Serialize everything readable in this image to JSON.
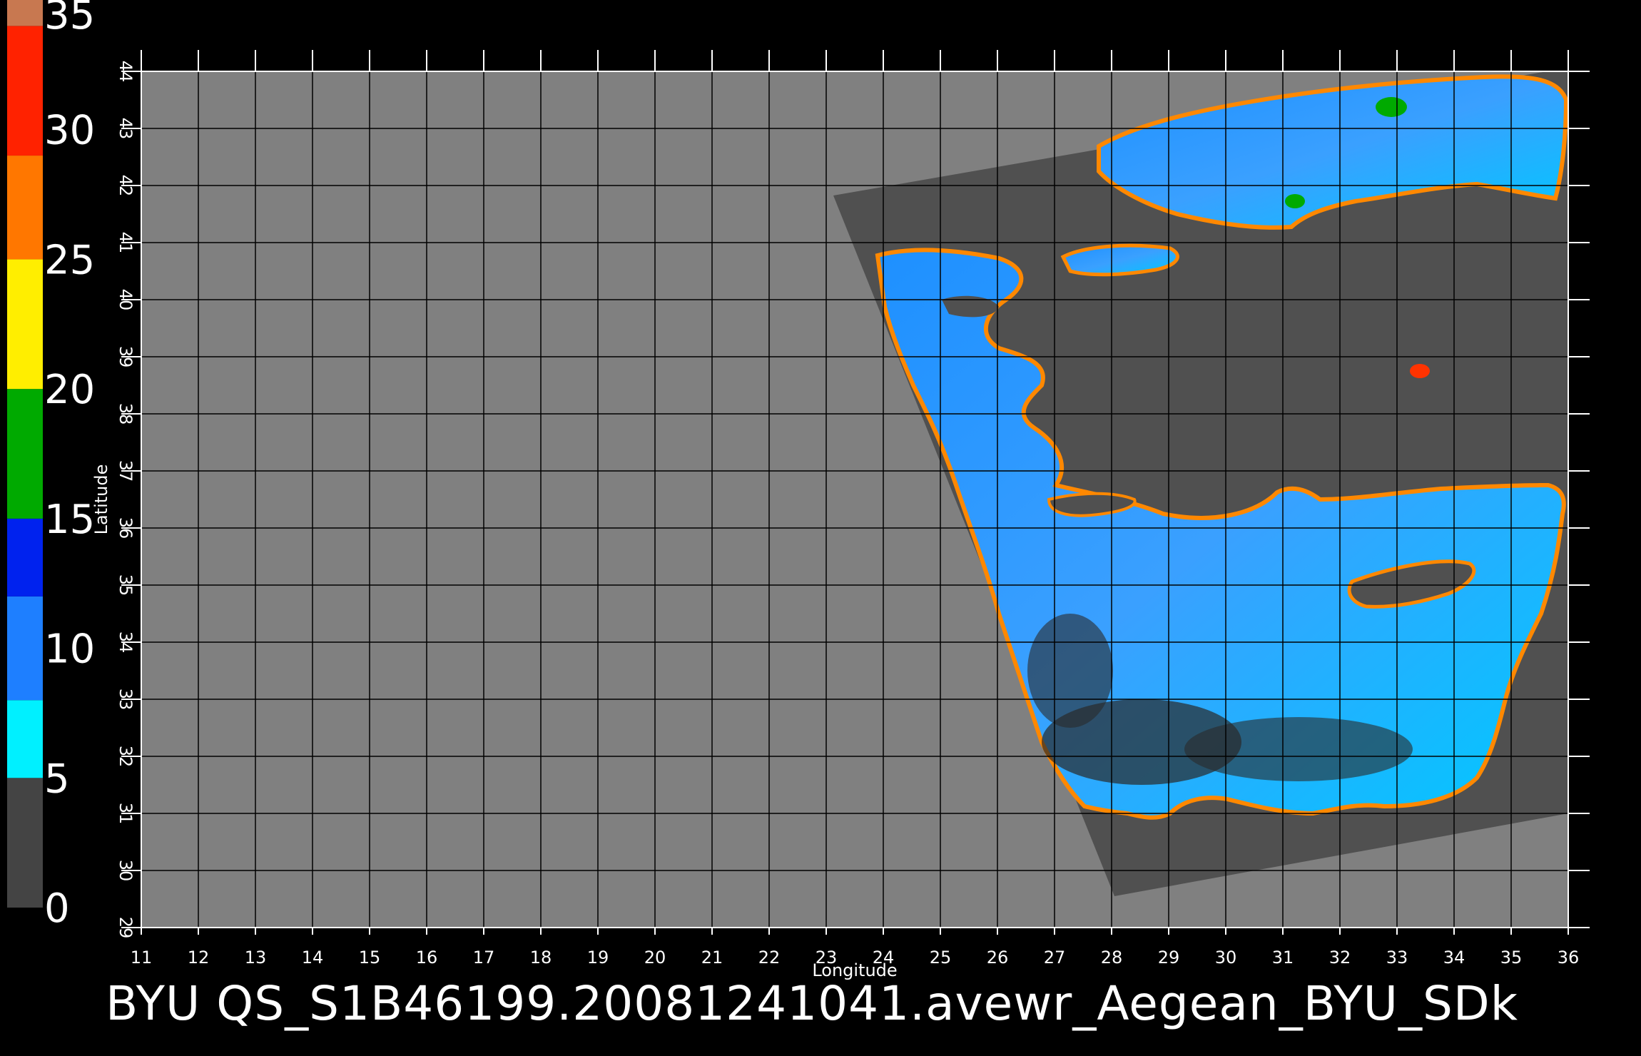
{
  "chart_data": {
    "type": "heatmap",
    "xlabel": "Longitude",
    "ylabel": "Latitude",
    "xlim": [
      11,
      36
    ],
    "ylim": [
      29,
      44
    ],
    "x_ticks": [
      "11",
      "12",
      "13",
      "14",
      "15",
      "16",
      "17",
      "18",
      "19",
      "20",
      "21",
      "22",
      "23",
      "24",
      "25",
      "26",
      "27",
      "28",
      "29",
      "30",
      "31",
      "32",
      "33",
      "34",
      "35",
      "36"
    ],
    "y_ticks": [
      "29",
      "30",
      "31",
      "32",
      "33",
      "34",
      "35",
      "36",
      "37",
      "38",
      "39",
      "40",
      "41",
      "42",
      "43",
      "44"
    ],
    "grid": true,
    "colorbar": {
      "labels": [
        "0",
        "5",
        "10",
        "15",
        "20",
        "25",
        "30",
        "35"
      ],
      "range": [
        0,
        35
      ],
      "colors": [
        "#333333",
        "#00ffff",
        "#1e90ff",
        "#0033ff",
        "#00aa00",
        "#ffff00",
        "#ff8800",
        "#ff2200",
        "#c87850"
      ]
    },
    "footer_text": "BYU  QS_S1B46199.20081241041.avewr_Aegean_BYU_SDk"
  },
  "colors": {
    "background": "#000000",
    "land_gray": "#808080",
    "swath_dark": "#505050",
    "grid": "#000000"
  }
}
